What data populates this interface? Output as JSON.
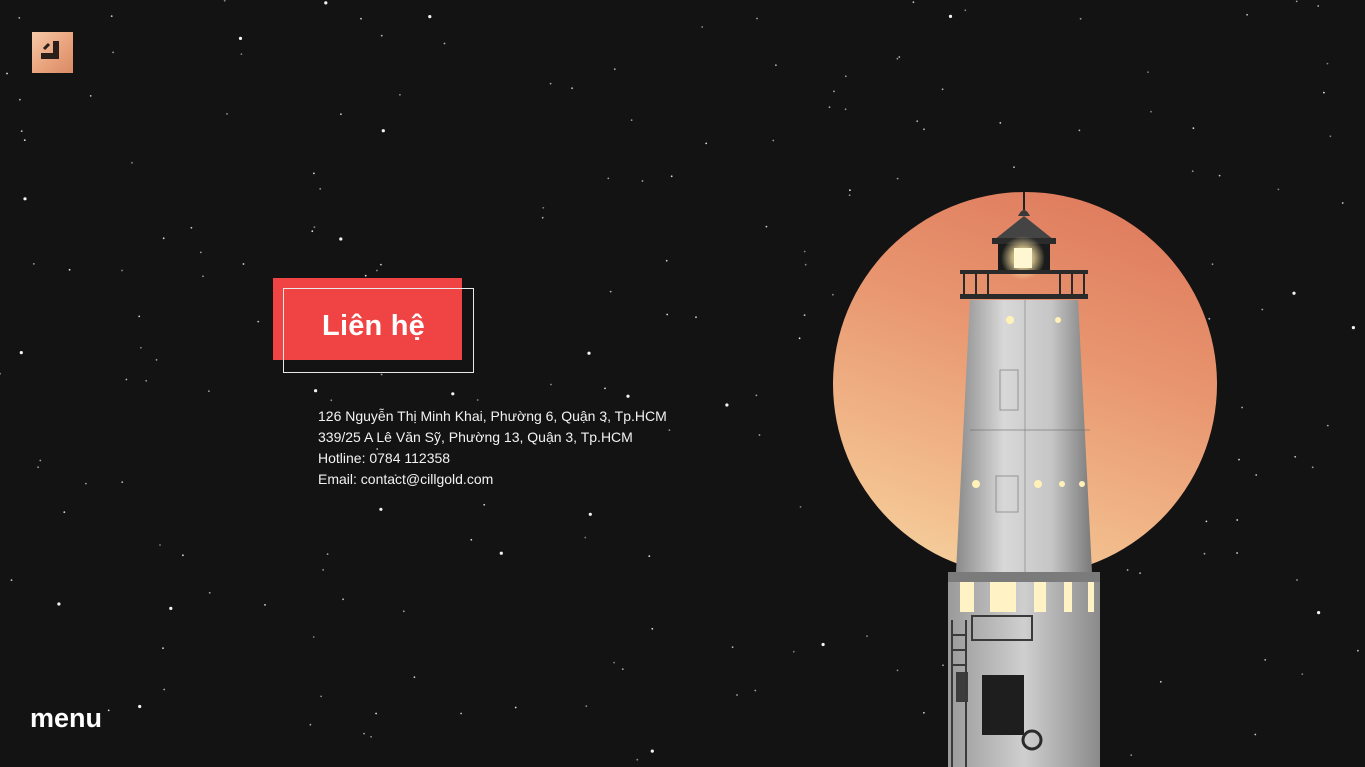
{
  "brand": {
    "logo_icon": "chillgold-logo-icon",
    "accent": "#e9a37d"
  },
  "title": {
    "label": "Liên hệ",
    "fill_color": "#f04444"
  },
  "contact": {
    "address1": "126 Nguyễn Thị Minh Khai, Phường 6, Quận 3, Tp.HCM",
    "address2": "339/25 A Lê Văn Sỹ, Phường 13, Quận 3, Tp.HCM",
    "hotline": "Hotline: 0784 112358",
    "email": "Email: contact@cillgold.com"
  },
  "menu": {
    "label": "menu"
  },
  "illustration": {
    "icon": "lighthouse-moon-illustration",
    "moon_color": "#e8956f"
  }
}
